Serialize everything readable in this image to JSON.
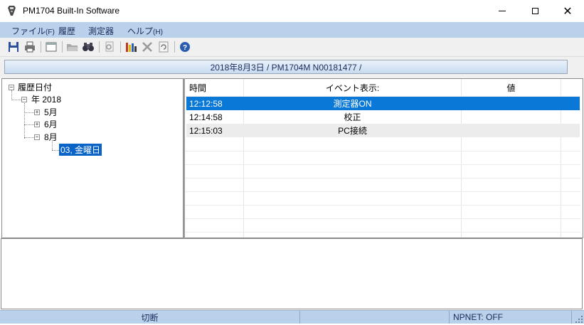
{
  "window": {
    "title": "PM1704 Built-In Software",
    "close_glyph": "✕"
  },
  "menu": [
    {
      "label": "ファイル",
      "accel": "(F)"
    },
    {
      "label": "履歴",
      "accel": ""
    },
    {
      "label": "測定器",
      "accel": ""
    },
    {
      "label": "ヘルプ",
      "accel": "(H)"
    }
  ],
  "toolbar": {
    "icons": [
      "save-icon",
      "print-icon",
      "new-window-icon",
      "open-folder-icon",
      "find-icon",
      "print-preview-icon",
      "chart-icon",
      "delete-icon",
      "refresh-icon",
      "help-icon"
    ]
  },
  "info_bar": {
    "text": "2018年8月3日 / PM1704M N00181477 /"
  },
  "tree": {
    "root": "履歴日付",
    "year": "年 2018",
    "months": [
      "5月",
      "6月",
      "8月"
    ],
    "day": "03, 金曜日",
    "expand_glyph": "+",
    "collapse_glyph": "−"
  },
  "events": {
    "columns": [
      "時間",
      "イベント表示:",
      "値"
    ],
    "rows": [
      {
        "time": "12:12:58",
        "event": "測定器ON",
        "value": "",
        "selected": true
      },
      {
        "time": "12:14:58",
        "event": "校正",
        "value": "",
        "selected": false
      },
      {
        "time": "12:15:03",
        "event": "PC接続",
        "value": "",
        "selected": false
      }
    ]
  },
  "status": {
    "connection": "切断",
    "npnet": "NPNET: OFF"
  },
  "colors": {
    "menu_bg": "#b9d1ea",
    "selection": "#0a78d7",
    "tree_selection": "#0a64c8"
  }
}
